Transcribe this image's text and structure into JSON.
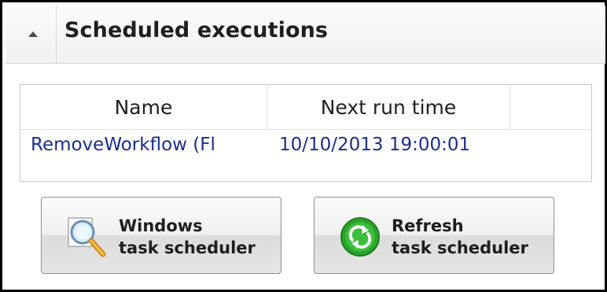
{
  "panel": {
    "title": "Scheduled executions"
  },
  "grid": {
    "columns": [
      "Name",
      "Next run time"
    ],
    "rows": [
      {
        "name": "RemoveWorkflow (Fl",
        "next_run_time": "10/10/2013 19:00:01"
      }
    ]
  },
  "buttons": {
    "windows": {
      "line1": "Windows",
      "line2": "task scheduler",
      "icon": "magnifier-icon"
    },
    "refresh": {
      "line1": "Refresh",
      "line2": "task scheduler",
      "icon": "refresh-icon"
    }
  },
  "colors": {
    "link_text": "#1a2e8c",
    "refresh_green": "#2aa42a"
  }
}
